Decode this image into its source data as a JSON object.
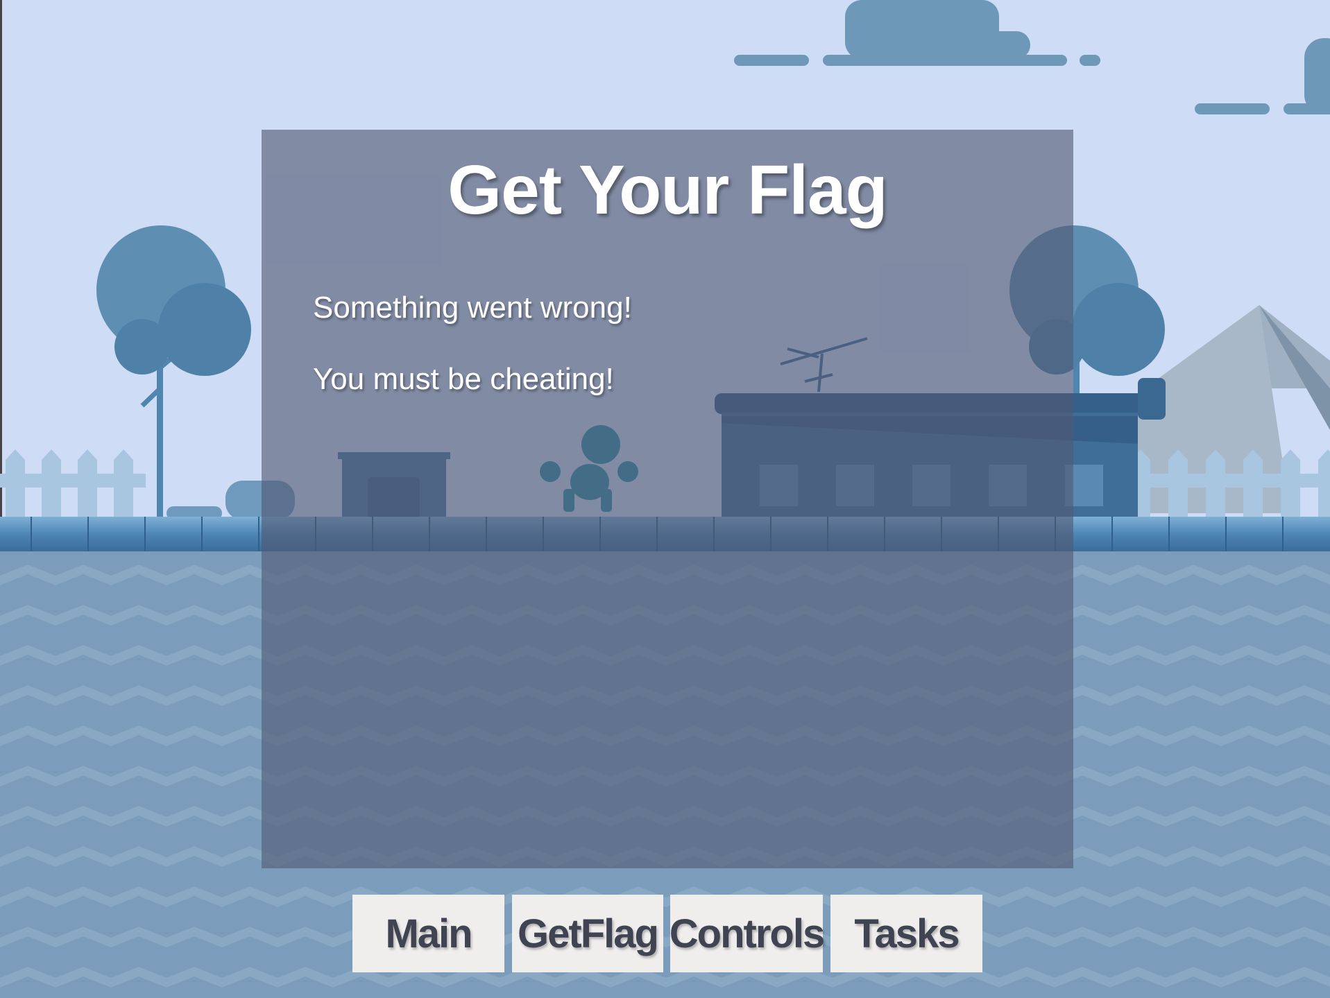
{
  "panel": {
    "title": "Get Your Flag",
    "messages": [
      "Something went wrong!",
      "You must be cheating!"
    ]
  },
  "nav": {
    "main": "Main",
    "getflag": "GetFlag",
    "controls": "Controls",
    "tasks": "Tasks"
  },
  "colors": {
    "sky": "#cfdcf5",
    "water": "#7b9dbb",
    "panel_overlay": "#505873",
    "button_bg": "#f0eded",
    "button_text": "#404452"
  },
  "scene": {
    "icons": [
      "cloud-icon",
      "tree-icon",
      "fence-icon",
      "house-icon",
      "character-icon",
      "antenna-icon",
      "pyramid-icon"
    ]
  }
}
